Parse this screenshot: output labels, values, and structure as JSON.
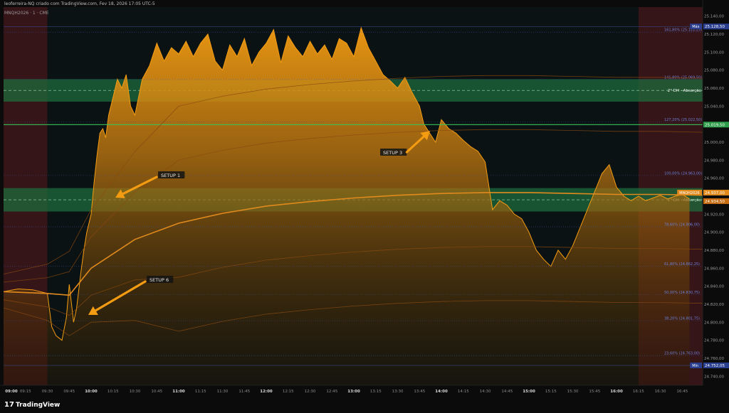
{
  "header": {
    "author_line": "leoferreira-NQ criado com TradingView.com, Fev 18, 2026 17:05 UTC-5",
    "symbol_line": "MNQH2026 · 1 · CME"
  },
  "branding": {
    "logo_glyph": "17",
    "name": "TradingView"
  },
  "colors": {
    "background": "#0b0b0b",
    "price_fill": "#f39c12",
    "vwap": "#e08a1e",
    "band": "#8a4a12",
    "green_zone": "#1f6b3d",
    "green_line": "#39c05a",
    "red_session": "#5a1f22",
    "blue_level": "#3a4ea0",
    "annotation_arrow": "#f39c12"
  },
  "annotations": [
    {
      "label": "SETUP 1"
    },
    {
      "label": "SETUP 3"
    },
    {
      "label": "SETUP 6"
    }
  ],
  "zones": [
    {
      "label": "2° DH - Absorção",
      "low": 25045,
      "high": 25070
    },
    {
      "label": "1° DH - Absorção",
      "low": 24923,
      "high": 24949
    }
  ],
  "levels": [
    {
      "label": "161,80% (25.122,25)",
      "value": 25122.25
    },
    {
      "label": "141,80% (25.069,50)",
      "value": 25069.5
    },
    {
      "label": "127,20% (25.022,50)",
      "value": 25022.5
    },
    {
      "label": "100,00% (24.963,00)",
      "value": 24963.0
    },
    {
      "label": "78,60% (24.906,00)",
      "value": 24906.0
    },
    {
      "label": "61,80% (24.862,25)",
      "value": 24862.25
    },
    {
      "label": "50,00% (24.830,75)",
      "value": 24830.75
    },
    {
      "label": "38,20% (24.801,75)",
      "value": 24801.75
    },
    {
      "label": "23,60% (24.763,00)",
      "value": 24763.0
    }
  ],
  "price_scale": {
    "ticks": [
      {
        "label": "25.140,00",
        "value": 25140
      },
      {
        "label": "25.120,00",
        "value": 25120
      },
      {
        "label": "25.100,00",
        "value": 25100
      },
      {
        "label": "25.080,00",
        "value": 25080
      },
      {
        "label": "25.060,00",
        "value": 25060
      },
      {
        "label": "25.040,00",
        "value": 25040
      },
      {
        "label": "25.000,00",
        "value": 25000
      },
      {
        "label": "24.980,00",
        "value": 24980
      },
      {
        "label": "24.960,00",
        "value": 24960
      },
      {
        "label": "24.920,00",
        "value": 24920
      },
      {
        "label": "24.900,00",
        "value": 24900
      },
      {
        "label": "24.880,00",
        "value": 24880
      },
      {
        "label": "24.860,00",
        "value": 24860
      },
      {
        "label": "24.840,00",
        "value": 24840
      },
      {
        "label": "24.820,00",
        "value": 24820
      },
      {
        "label": "24.800,00",
        "value": 24800
      },
      {
        "label": "24.780,00",
        "value": 24780
      },
      {
        "label": "24.760,00",
        "value": 24760
      },
      {
        "label": "24.740,00",
        "value": 24740
      }
    ],
    "badges": [
      {
        "label": "Máx",
        "value_label": "25.128,50",
        "value": 25128.5,
        "color": "#2a3f8f"
      },
      {
        "label": "",
        "value_label": "25.019,50",
        "value": 25019.5,
        "color": "#2e9c4a"
      },
      {
        "label": "MNQH2026",
        "value_label": "24.937,00",
        "value": 24944.0,
        "color": "#e08a1e"
      },
      {
        "label": "",
        "value_label": "24.934,50",
        "value": 24934.5,
        "color": "#c76b10"
      },
      {
        "label": "Mín",
        "value_label": "24.752,05",
        "value": 24752.05,
        "color": "#2a3f8f"
      }
    ]
  },
  "time_axis": {
    "ticks": [
      {
        "label": "09:00",
        "bold": true
      },
      {
        "label": "09:15",
        "bold": false
      },
      {
        "label": "09:30",
        "bold": false
      },
      {
        "label": "09:45",
        "bold": false
      },
      {
        "label": "10:00",
        "bold": true
      },
      {
        "label": "10:15",
        "bold": false
      },
      {
        "label": "10:30",
        "bold": false
      },
      {
        "label": "10:45",
        "bold": false
      },
      {
        "label": "11:00",
        "bold": true
      },
      {
        "label": "11:15",
        "bold": false
      },
      {
        "label": "11:30",
        "bold": false
      },
      {
        "label": "11:45",
        "bold": false
      },
      {
        "label": "12:00",
        "bold": true
      },
      {
        "label": "12:15",
        "bold": false
      },
      {
        "label": "12:30",
        "bold": false
      },
      {
        "label": "12:45",
        "bold": false
      },
      {
        "label": "13:00",
        "bold": true
      },
      {
        "label": "13:15",
        "bold": false
      },
      {
        "label": "13:30",
        "bold": false
      },
      {
        "label": "13:45",
        "bold": false
      },
      {
        "label": "14:00",
        "bold": true
      },
      {
        "label": "14:15",
        "bold": false
      },
      {
        "label": "14:30",
        "bold": false
      },
      {
        "label": "14:45",
        "bold": false
      },
      {
        "label": "15:00",
        "bold": true
      },
      {
        "label": "15:15",
        "bold": false
      },
      {
        "label": "15:30",
        "bold": false
      },
      {
        "label": "15:45",
        "bold": false
      },
      {
        "label": "16:00",
        "bold": true
      },
      {
        "label": "16:15",
        "bold": false
      },
      {
        "label": "16:30",
        "bold": false
      },
      {
        "label": "16:45",
        "bold": false
      }
    ]
  },
  "chart_data": {
    "type": "area",
    "symbol": "MNQH2026",
    "interval": "1",
    "ylim": [
      24730,
      25150
    ],
    "grid": false,
    "sessions": [
      {
        "shade": "red",
        "from": "09:00",
        "to": "09:30"
      },
      {
        "shade": "red",
        "from": "16:15",
        "to": "17:00"
      }
    ],
    "series": [
      {
        "type": "area",
        "x": [
          "09:00",
          "09:10",
          "09:20",
          "09:30",
          "09:33",
          "09:36",
          "09:40",
          "09:43",
          "09:45",
          "09:48",
          "09:50",
          "09:53",
          "09:55",
          "09:57",
          "10:00",
          "10:02",
          "10:04",
          "10:06",
          "10:08",
          "10:10",
          "10:12",
          "10:15",
          "10:18",
          "10:21",
          "10:24",
          "10:27",
          "10:30",
          "10:35",
          "10:40",
          "10:45",
          "10:50",
          "10:55",
          "11:00",
          "11:05",
          "11:10",
          "11:15",
          "11:20",
          "11:25",
          "11:30",
          "11:35",
          "11:40",
          "11:45",
          "11:50",
          "11:55",
          "12:00",
          "12:05",
          "12:10",
          "12:15",
          "12:20",
          "12:25",
          "12:30",
          "12:35",
          "12:40",
          "12:45",
          "12:50",
          "12:55",
          "13:00",
          "13:05",
          "13:10",
          "13:15",
          "13:20",
          "13:25",
          "13:30",
          "13:35",
          "13:40",
          "13:45",
          "13:48",
          "13:52",
          "13:56",
          "14:00",
          "14:05",
          "14:10",
          "14:15",
          "14:20",
          "14:25",
          "14:30",
          "14:35",
          "14:40",
          "14:45",
          "14:50",
          "14:55",
          "15:00",
          "15:05",
          "15:10",
          "15:15",
          "15:20",
          "15:25",
          "15:30",
          "15:35",
          "15:40",
          "15:45",
          "15:50",
          "15:55",
          "16:00",
          "16:05",
          "16:10",
          "16:15",
          "16:20",
          "16:25",
          "16:30",
          "16:35",
          "16:40",
          "16:45",
          "16:50"
        ],
        "values": [
          24834,
          24837,
          24836,
          24832,
          24795,
          24785,
          24780,
          24805,
          24842,
          24800,
          24815,
          24856,
          24880,
          24900,
          24920,
          24955,
          24985,
          25010,
          25015,
          25005,
          25030,
          25050,
          25070,
          25060,
          25075,
          25040,
          25030,
          25070,
          25085,
          25110,
          25090,
          25105,
          25098,
          25112,
          25095,
          25110,
          25120,
          25090,
          25080,
          25108,
          25095,
          25115,
          25085,
          25100,
          25110,
          25125,
          25088,
          25118,
          25105,
          25095,
          25112,
          25098,
          25108,
          25092,
          25115,
          25110,
          25095,
          25127,
          25105,
          25090,
          25075,
          25068,
          25060,
          25072,
          25055,
          25040,
          25020,
          25010,
          25000,
          25025,
          25015,
          25010,
          25002,
          24995,
          24990,
          24978,
          24925,
          24935,
          24930,
          24920,
          24915,
          24900,
          24880,
          24870,
          24862,
          24880,
          24870,
          24885,
          24905,
          24925,
          24945,
          24965,
          24975,
          24950,
          24940,
          24935,
          24940,
          24935,
          24938,
          24941,
          24937,
          24940,
          24942,
          24937
        ]
      },
      {
        "name": "",
        "type": "line",
        "x": [
          "09:00",
          "09:30",
          "09:45",
          "10:00",
          "10:30",
          "11:00",
          "11:30",
          "12:00",
          "12:30",
          "13:00",
          "13:30",
          "14:00",
          "14:30",
          "15:00",
          "15:30",
          "16:00",
          "16:30",
          "17:00"
        ],
        "values": [
          24834,
          24832,
          24830,
          24860,
          24892,
          24910,
          24921,
          24929,
          24934,
          24938,
          24941,
          24943,
          24944,
          24944,
          24943,
          24942,
          24942,
          24941
        ]
      }
    ]
  }
}
